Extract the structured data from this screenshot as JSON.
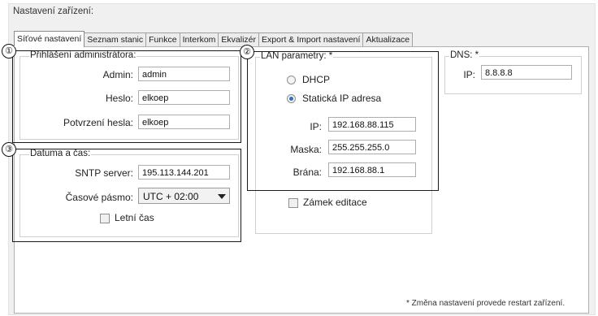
{
  "title": "Nastavení zařízení:",
  "tabs": [
    {
      "label": "Síťové nastavení"
    },
    {
      "label": "Seznam stanic"
    },
    {
      "label": "Funkce"
    },
    {
      "label": "Interkom"
    },
    {
      "label": "Ekvalizér"
    },
    {
      "label": "Export & Import nastavení"
    },
    {
      "label": "Aktualizace"
    }
  ],
  "admin": {
    "legend": "Přihlášení administrátora:",
    "admin_label": "Admin:",
    "admin_value": "admin",
    "password_label": "Heslo:",
    "password_value": "elkoep",
    "confirm_label": "Potvrzení hesla:",
    "confirm_value": "elkoep"
  },
  "datetime": {
    "legend": "Datuma a čas:",
    "sntp_label": "SNTP server:",
    "sntp_value": "195.113.144.201",
    "tz_label": "Časové pásmo:",
    "tz_value": "UTC + 02:00",
    "dst_label": "Letní čas"
  },
  "lan": {
    "legend": "LAN parametry: *",
    "dhcp_label": "DHCP",
    "static_label": "Statická IP adresa",
    "ip_label": "IP:",
    "ip_value": "192.168.88.115",
    "mask_label": "Maska:",
    "mask_value": "255.255.255.0",
    "gateway_label": "Brána:",
    "gateway_value": "192.168.88.1",
    "lock_label": "Zámek editace"
  },
  "dns": {
    "legend": "DNS: *",
    "ip_label": "IP:",
    "ip_value": "8.8.8.8"
  },
  "annotations": [
    "①",
    "②",
    "③"
  ],
  "footnote": "* Změna nastavení provede restart zařízení."
}
